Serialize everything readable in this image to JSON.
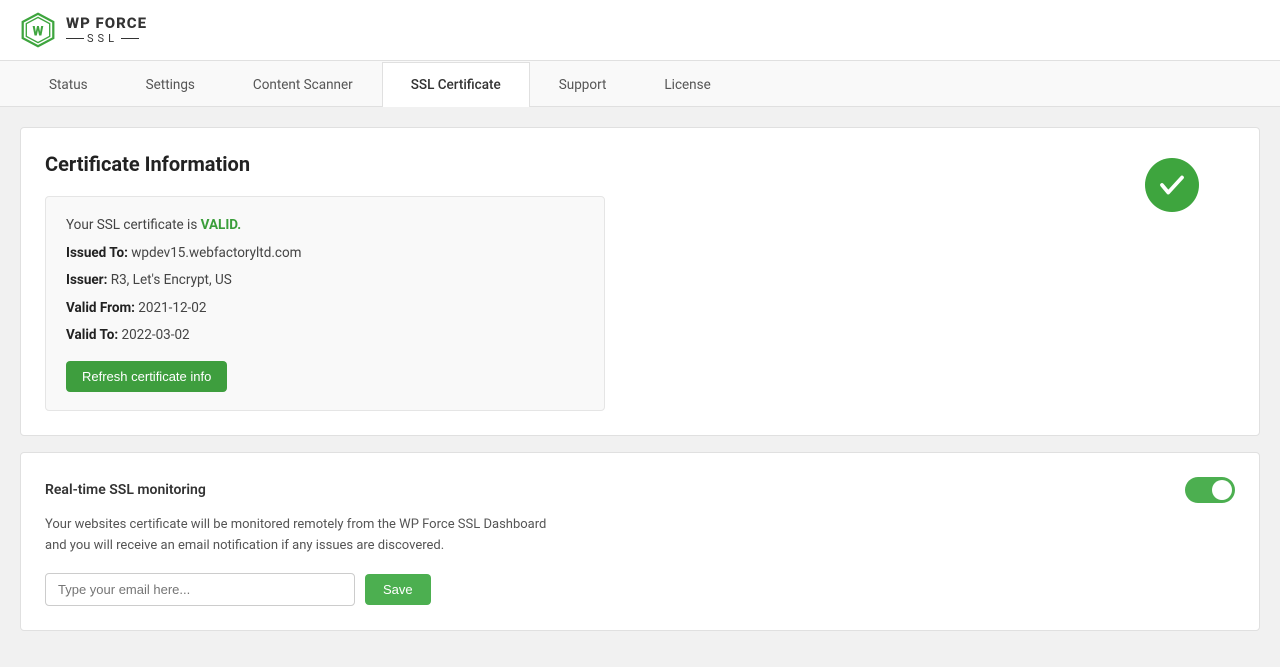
{
  "header": {
    "logo_wp_force": "WP FORCE",
    "logo_ssl": "— SSL —"
  },
  "tabs": {
    "items": [
      {
        "id": "status",
        "label": "Status",
        "active": false
      },
      {
        "id": "settings",
        "label": "Settings",
        "active": false
      },
      {
        "id": "content-scanner",
        "label": "Content Scanner",
        "active": false
      },
      {
        "id": "ssl-certificate",
        "label": "SSL Certificate",
        "active": true
      },
      {
        "id": "support",
        "label": "Support",
        "active": false
      },
      {
        "id": "license",
        "label": "License",
        "active": false
      }
    ]
  },
  "certificate_section": {
    "title": "Certificate Information",
    "validity_prefix": "Your SSL certificate is ",
    "validity_status": "VALID.",
    "issued_to_label": "Issued To:",
    "issued_to_value": " wpdev15.webfactoryltd.com",
    "issuer_label": "Issuer:",
    "issuer_value": " R3, Let's Encrypt, US",
    "valid_from_label": "Valid From:",
    "valid_from_value": " 2021-12-02",
    "valid_to_label": "Valid To:",
    "valid_to_value": " 2022-03-02",
    "refresh_button": "Refresh certificate info"
  },
  "monitoring_section": {
    "label": "Real-time SSL monitoring",
    "description": "Your websites certificate will be monitored remotely from the WP Force SSL Dashboard and you will receive an email notification if any issues are discovered.",
    "email_placeholder": "Type your email here...",
    "save_button": "Save",
    "toggle_on": true
  },
  "colors": {
    "green": "#3ea53e",
    "valid_green": "#3a9e3a",
    "button_green": "#3e9e3e",
    "toggle_green": "#4caf50"
  }
}
